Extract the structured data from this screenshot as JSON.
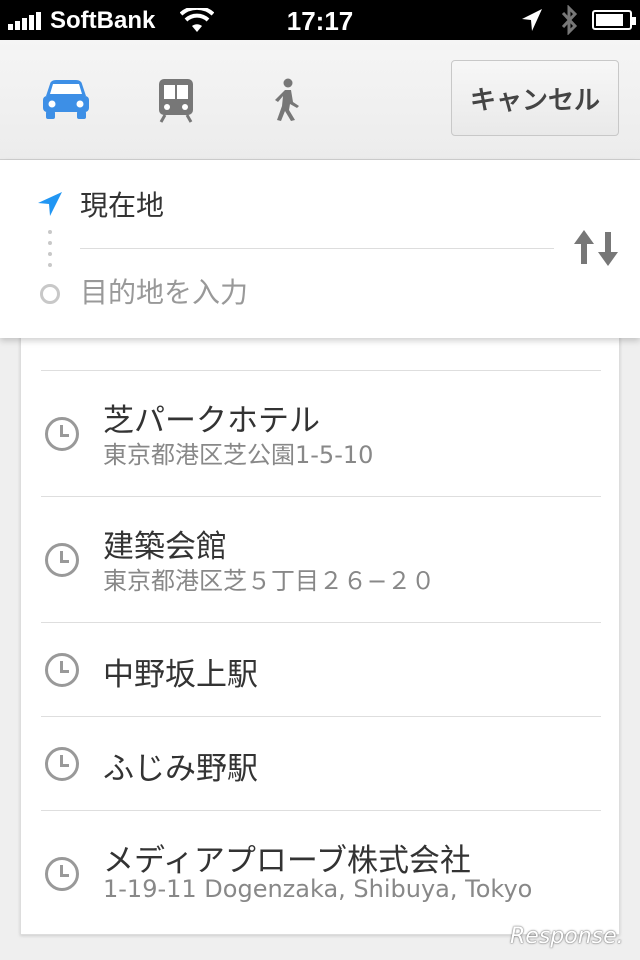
{
  "status_bar": {
    "carrier": "SoftBank",
    "time": "17:17",
    "battery_level": 0.85
  },
  "toolbar": {
    "modes": [
      {
        "icon": "car-icon",
        "selected": true,
        "color": "#3d8fe6"
      },
      {
        "icon": "train-icon",
        "selected": false,
        "color": "#777777"
      },
      {
        "icon": "walk-icon",
        "selected": false,
        "color": "#777777"
      }
    ],
    "cancel_label": "キャンセル"
  },
  "route": {
    "origin": "現在地",
    "destination_placeholder": "目的地を入力",
    "origin_icon_color": "#2196f3"
  },
  "history": {
    "items": [
      {
        "title": "芝パークホテル",
        "subtitle": "東京都港区芝公園1-5-10"
      },
      {
        "title": "建築会館",
        "subtitle": "東京都港区芝５丁目２６−２０"
      },
      {
        "title": "中野坂上駅",
        "subtitle": ""
      },
      {
        "title": "ふじみ野駅",
        "subtitle": ""
      },
      {
        "title": "メディアプローブ株式会社",
        "subtitle": "1-19-11 Dogenzaka, Shibuya, Tokyo"
      }
    ]
  },
  "watermark": "Response."
}
